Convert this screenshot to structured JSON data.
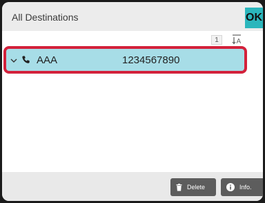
{
  "header": {
    "title": "All Destinations",
    "ok_label": "OK"
  },
  "pagination": {
    "page": "1"
  },
  "destinations": [
    {
      "name": "AAA",
      "number": "1234567890",
      "type": "fax-phone-icon",
      "selected": true
    }
  ],
  "footer": {
    "delete_label": "Delete",
    "info_label": "Info."
  },
  "colors": {
    "accent": "#2bb6bc",
    "selection": "#a7dde7",
    "highlight_border": "#d3213b"
  }
}
